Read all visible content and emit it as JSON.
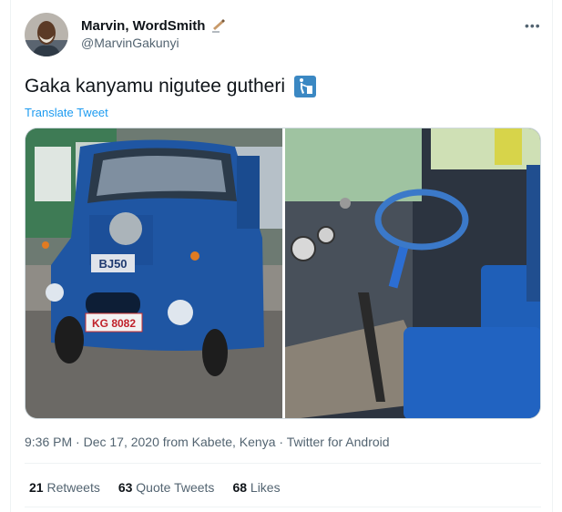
{
  "author": {
    "name": "Marvin, WordSmith",
    "handle": "@MarvinGakunyi",
    "name_emoji_icon": "writing-hand-icon"
  },
  "tweet": {
    "text": "Gaka kanyamu nigutee gutheri",
    "emoji_icon": "litter-bin-sign-icon",
    "translate_label": "Translate Tweet"
  },
  "media": {
    "photos": [
      {
        "description_icon": "blue-car-front-photo"
      },
      {
        "description_icon": "car-interior-steering-wheel-photo"
      }
    ],
    "plate_text": "KG 8082",
    "badge_text": "BJ50"
  },
  "meta": {
    "time": "9:36 PM",
    "separator": "·",
    "date": "Dec 17, 2020 from Kabete, Kenya",
    "source": "Twitter for Android"
  },
  "stats": {
    "retweets_count": "21",
    "retweets_label": "Retweets",
    "quotes_count": "63",
    "quotes_label": "Quote Tweets",
    "likes_count": "68",
    "likes_label": "Likes"
  },
  "colors": {
    "link": "#1d9bf0",
    "secondary_text": "#536471",
    "primary_text": "#0f1419"
  }
}
